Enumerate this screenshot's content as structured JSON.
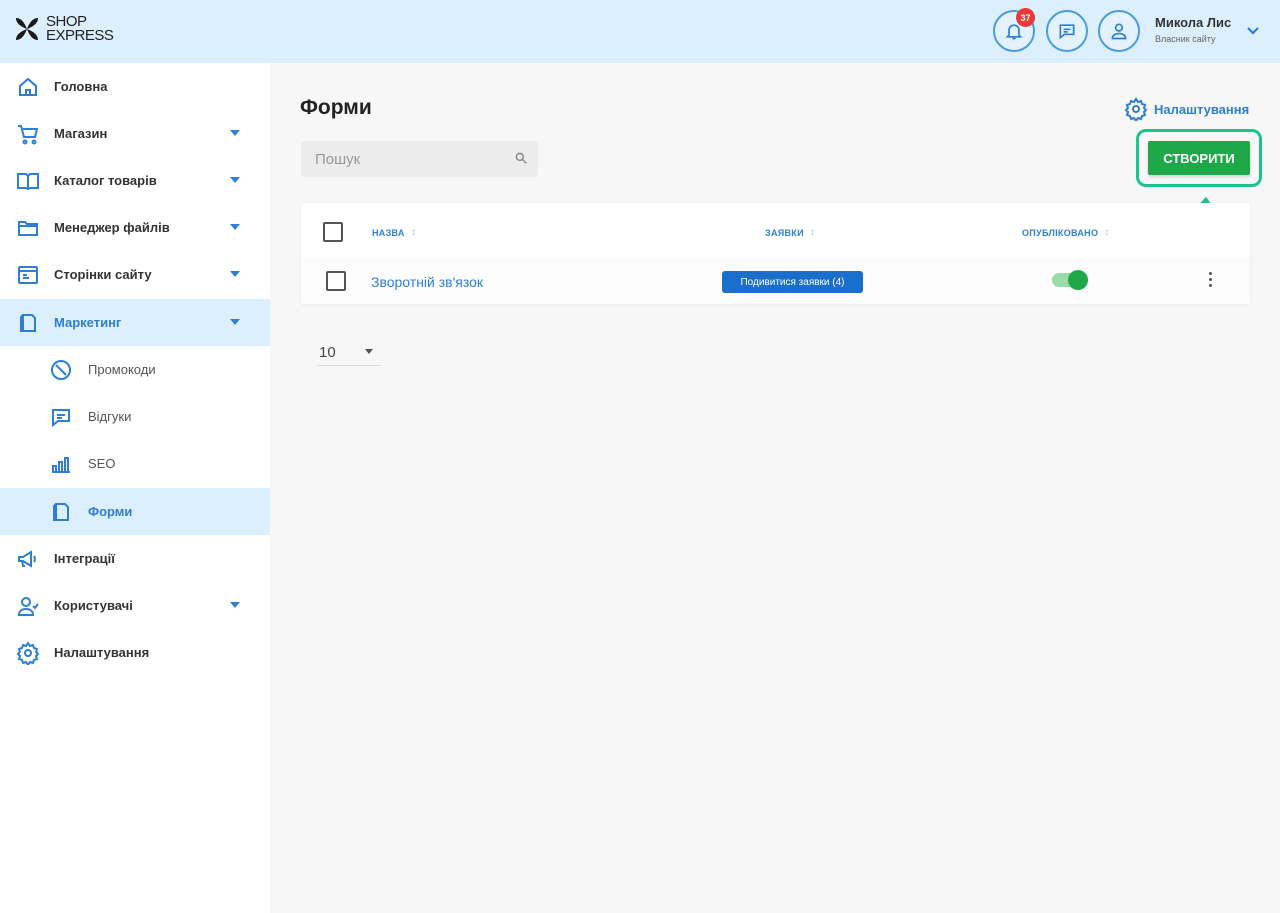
{
  "header": {
    "logo_line1": "SHOP",
    "logo_line2": "EXPRESS",
    "notifications_count": "37",
    "user_name": "Микола Лис",
    "user_role": "Власник сайту"
  },
  "sidebar": {
    "items": [
      {
        "label": "Головна",
        "icon": "home-icon"
      },
      {
        "label": "Магазин",
        "icon": "cart-icon"
      },
      {
        "label": "Каталог товарів",
        "icon": "catalog-icon"
      },
      {
        "label": "Менеджер файлів",
        "icon": "folder-icon"
      },
      {
        "label": "Сторінки сайту",
        "icon": "pages-icon"
      },
      {
        "label": "Маркетинг",
        "icon": "marketing-icon"
      },
      {
        "label": "Інтеграції",
        "icon": "megaphone-icon"
      },
      {
        "label": "Користувачі",
        "icon": "users-icon"
      },
      {
        "label": "Налаштування",
        "icon": "gear-icon"
      }
    ],
    "sub_items": [
      {
        "label": "Промокоди",
        "icon": "promo-icon"
      },
      {
        "label": "Відгуки",
        "icon": "reviews-icon"
      },
      {
        "label": "SEO",
        "icon": "seo-icon"
      },
      {
        "label": "Форми",
        "icon": "forms-icon"
      }
    ]
  },
  "main": {
    "title": "Форми",
    "settings_label": "Налаштування",
    "search_placeholder": "Пошук",
    "create_label": "СТВОРИТИ",
    "table": {
      "col_name": "НАЗВА",
      "col_requests": "ЗАЯВКИ",
      "col_published": "ОПУБЛІКОВАНО",
      "rows": [
        {
          "name": "Зворотній зв'язок",
          "requests_button": "Подивитися заявки (4)",
          "published": true
        }
      ]
    },
    "page_size": "10"
  },
  "colors": {
    "accent": "#2d7fd3",
    "header_bg": "#dcefff",
    "create_green": "#1fa84a",
    "highlight": "#1ec28b"
  }
}
